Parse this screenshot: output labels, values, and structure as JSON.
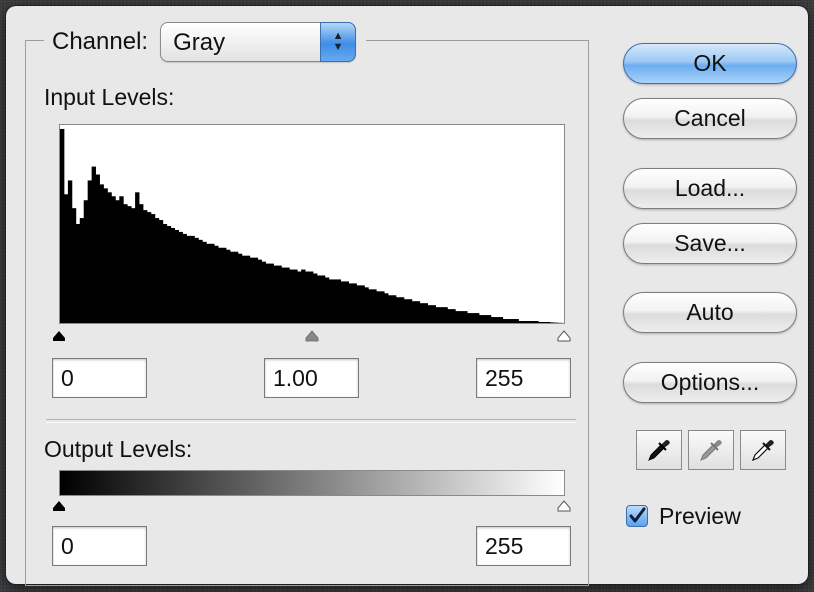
{
  "dialog": {
    "channel": {
      "label": "Channel:",
      "value": "Gray",
      "icon": "up-down-arrows-icon"
    },
    "input_levels": {
      "label": "Input Levels:",
      "black": "0",
      "gamma": "1.00",
      "white": "255"
    },
    "output_levels": {
      "label": "Output Levels:",
      "black": "0",
      "white": "255"
    },
    "buttons": {
      "ok": "OK",
      "cancel": "Cancel",
      "load": "Load...",
      "save": "Save...",
      "auto": "Auto",
      "options": "Options..."
    },
    "eyedroppers": [
      "black-point-eyedropper-icon",
      "gray-point-eyedropper-icon",
      "white-point-eyedropper-icon"
    ],
    "preview": {
      "label": "Preview",
      "checked": true
    }
  },
  "colors": {
    "default_button": "#6dadf0",
    "dialog_bg": "#e8e8e8",
    "histogram_fill": "#000000"
  },
  "chart_data": {
    "type": "area",
    "x": [
      0,
      2,
      4,
      6,
      8,
      10,
      12,
      14,
      16,
      18,
      20,
      22,
      24,
      26,
      28,
      30,
      32,
      34,
      36,
      38,
      40,
      42,
      44,
      46,
      48,
      50,
      52,
      54,
      56,
      58,
      60,
      62,
      64,
      66,
      68,
      70,
      72,
      74,
      76,
      78,
      80,
      82,
      84,
      86,
      88,
      90,
      92,
      94,
      96,
      98,
      100,
      102,
      104,
      106,
      108,
      110,
      112,
      114,
      116,
      118,
      120,
      122,
      124,
      126,
      128,
      130,
      132,
      134,
      136,
      138,
      140,
      142,
      144,
      146,
      148,
      150,
      152,
      154,
      156,
      158,
      160,
      162,
      164,
      166,
      168,
      170,
      172,
      174,
      176,
      178,
      180,
      182,
      184,
      186,
      188,
      190,
      192,
      194,
      196,
      198,
      200,
      202,
      204,
      206,
      208,
      210,
      212,
      214,
      216,
      218,
      220,
      222,
      224,
      226,
      228,
      230,
      232,
      234,
      236,
      238,
      240,
      242,
      244,
      246,
      248,
      250,
      252,
      254,
      255
    ],
    "y": [
      98,
      65,
      72,
      58,
      50,
      53,
      62,
      72,
      79,
      75,
      70,
      68,
      66,
      64,
      62,
      64,
      60,
      59,
      58,
      66,
      60,
      57,
      56,
      55,
      53,
      52,
      50,
      49,
      48,
      47,
      46,
      45,
      44,
      44,
      43,
      42,
      41,
      40,
      40,
      39,
      38,
      38,
      37,
      36,
      36,
      35,
      34,
      34,
      33,
      33,
      32,
      31,
      30,
      30,
      29,
      29,
      28,
      28,
      27,
      27,
      26,
      27,
      26,
      26,
      25,
      24,
      24,
      23,
      22,
      22,
      22,
      21,
      21,
      20,
      20,
      19,
      19,
      18,
      17,
      17,
      16,
      16,
      15,
      14,
      14,
      13,
      13,
      12,
      12,
      11,
      11,
      10,
      10,
      9,
      9,
      8,
      8,
      8,
      7,
      7,
      6,
      6,
      6,
      5,
      5,
      5,
      4,
      4,
      4,
      3,
      3,
      3,
      2,
      2,
      2,
      2,
      1,
      1,
      1,
      1,
      1,
      0.5,
      0.5,
      0.5,
      0.3,
      0.2,
      0.1,
      0,
      0
    ],
    "xlim": [
      0,
      255
    ],
    "ylim": [
      0,
      100
    ]
  }
}
